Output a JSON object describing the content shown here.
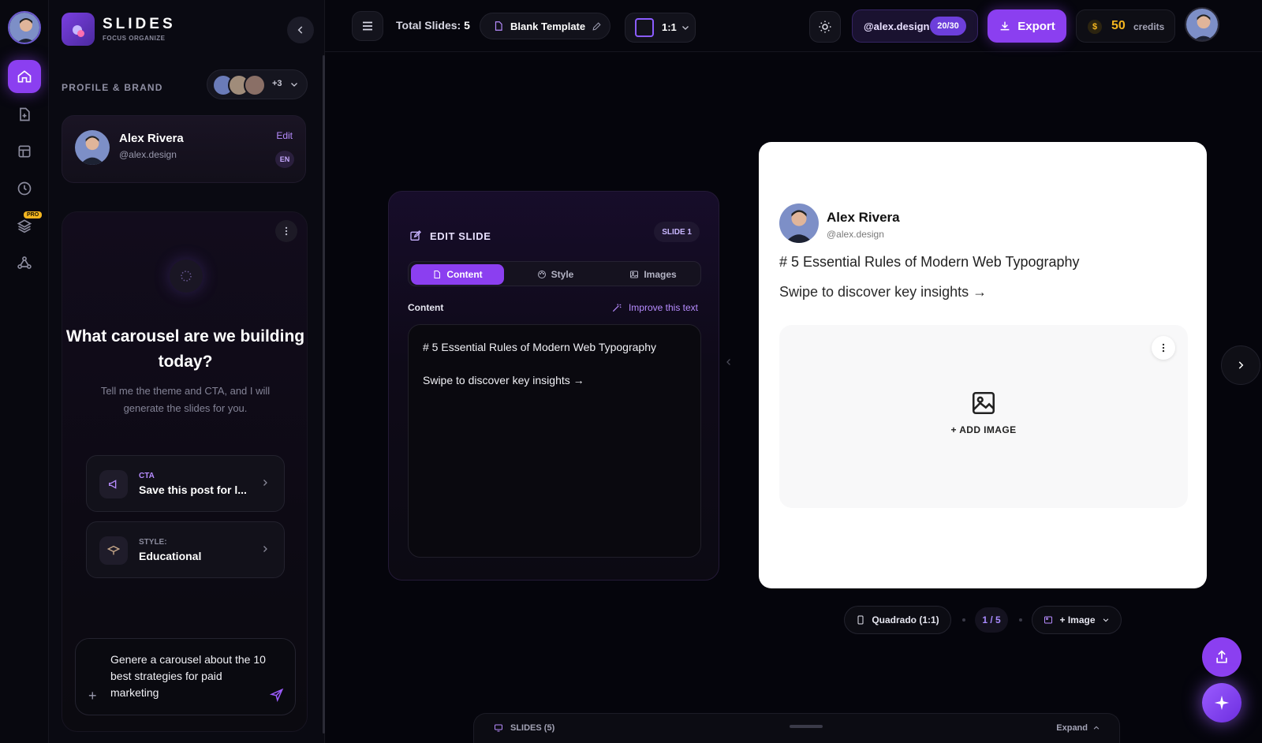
{
  "app": {
    "brand": "SLIDES",
    "brand_sub": "FOCUS ORGANIZE"
  },
  "sidebar": {
    "section_label": "PROFILE & BRAND",
    "profiles_more": "+3",
    "pro_badge": "PRO",
    "profile": {
      "name": "Alex Rivera",
      "handle": "@alex.design",
      "edit_label": "Edit",
      "lang": "EN"
    },
    "chat": {
      "title": "What carousel are we building today?",
      "subtitle": "Tell me the theme and CTA, and I will generate the slides for you.",
      "cta_label": "CTA",
      "cta_value": "Save this post for l...",
      "style_label": "STYLE:",
      "style_value": "Educational",
      "composer_text": "Genere a carousel about the 10 best strategies for paid marketing"
    }
  },
  "topbar": {
    "total_label": "Total Slides:",
    "total_value": "5",
    "template": "Blank Template",
    "ratio": "1:1",
    "handle": "@alex.design",
    "handle_count": "20/30",
    "export_label": "Export",
    "credits_value": "50",
    "credits_label": "credits",
    "coin_symbol": "$"
  },
  "editor": {
    "title": "EDIT SLIDE",
    "badge": "SLIDE 1",
    "tabs": [
      "Content",
      "Style",
      "Images"
    ],
    "content_label": "Content",
    "improve_label": "Improve this text",
    "text_line1": "# 5 Essential Rules of Modern Web Typography",
    "text_line2": "Swipe to discover key insights →"
  },
  "preview": {
    "name": "Alex Rivera",
    "handle": "@alex.design",
    "heading": "# 5 Essential Rules of Modern Web Typography",
    "subtext": "Swipe to discover key insights →",
    "add_image": "+ ADD IMAGE"
  },
  "bottom": {
    "format": "Quadrado (1:1)",
    "page": "1 / 5",
    "image_btn": "+ Image",
    "slides_label": "SLIDES (5)",
    "expand_label": "Expand"
  },
  "colors": {
    "accent": "#8b3ff0",
    "background": "#05050c",
    "gold": "#f5b61f"
  }
}
